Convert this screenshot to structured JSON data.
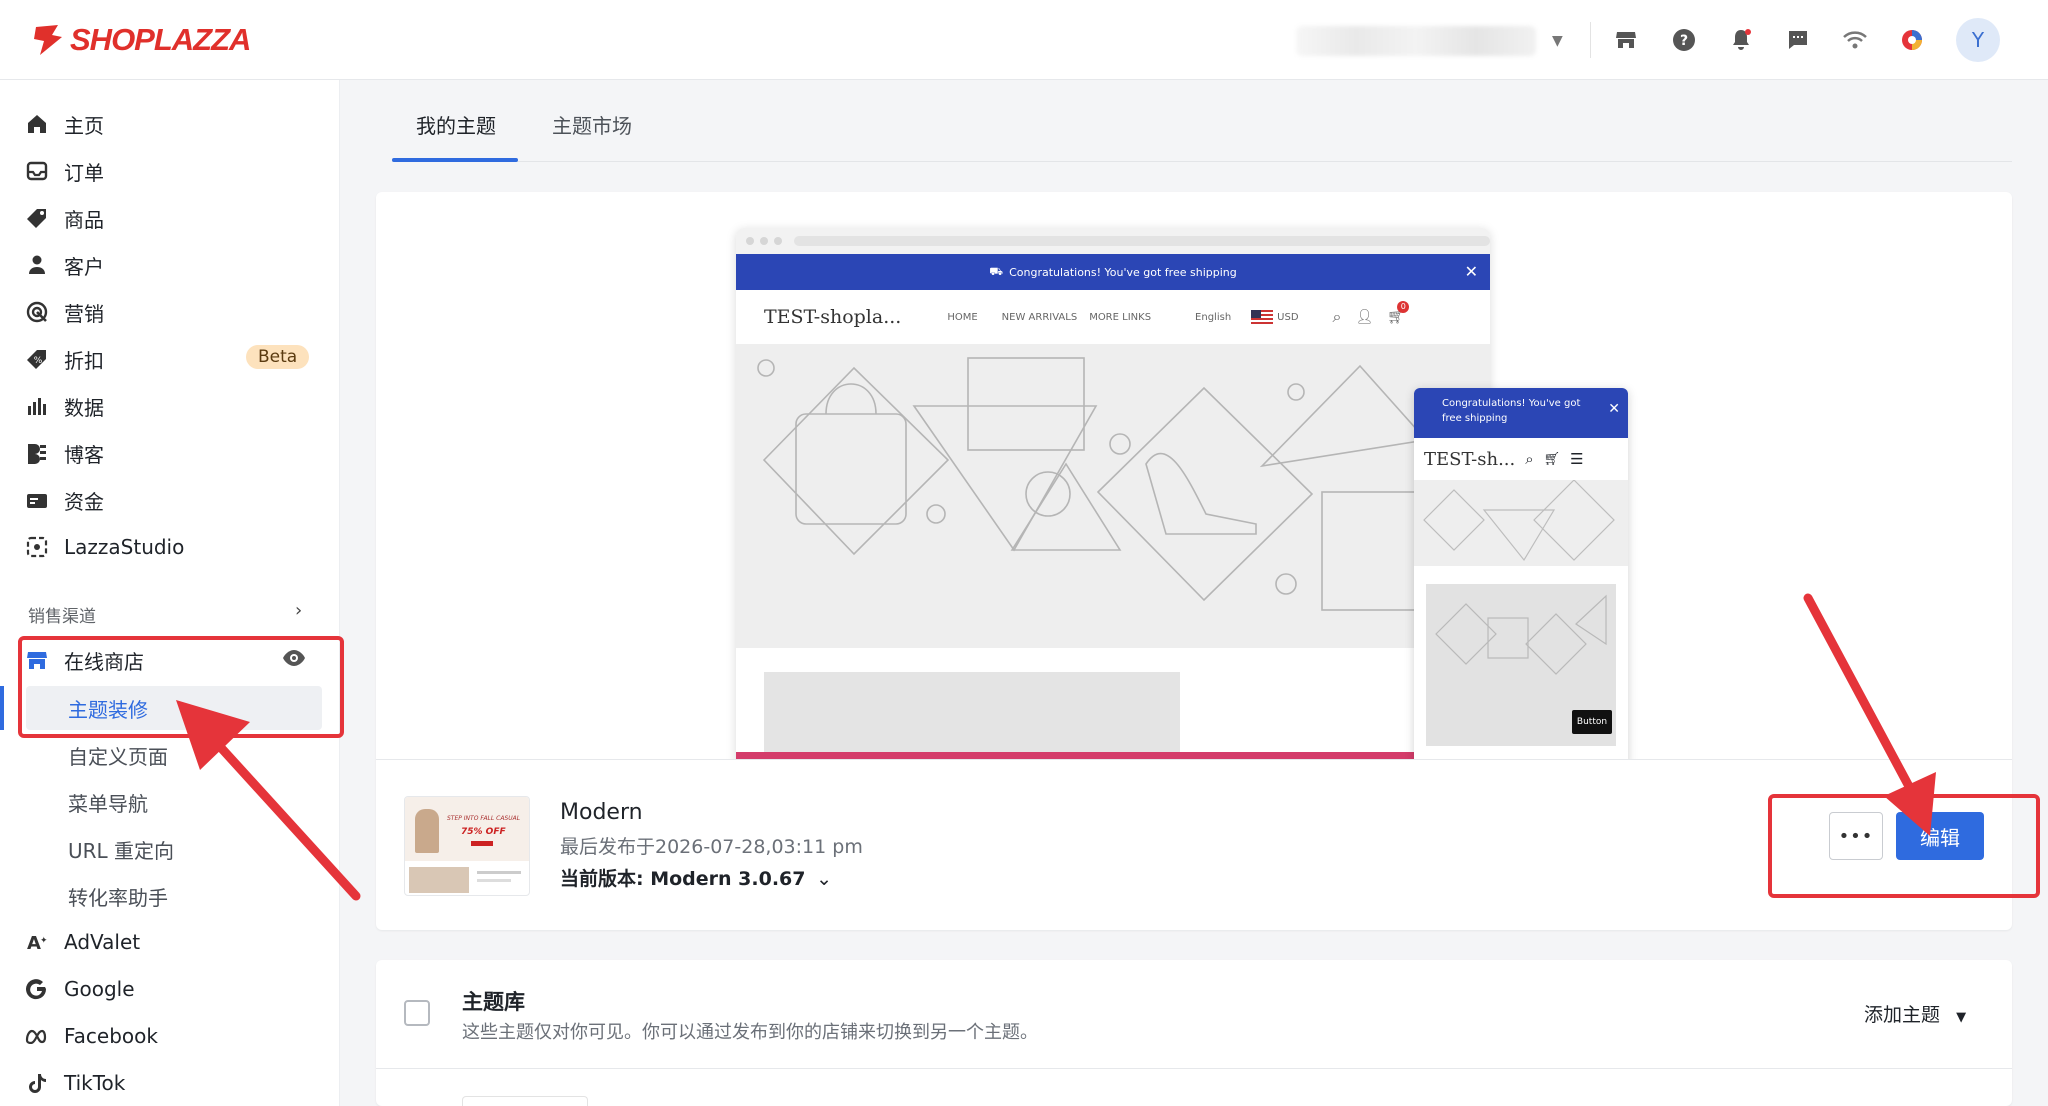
{
  "app": {
    "logo_text": "SHOPLAZZA",
    "avatar_initial": "Y"
  },
  "colors": {
    "brand": "#e0302b",
    "accent": "#2f6bdf",
    "highlight": "#e5343a"
  },
  "topbar_icons": [
    "store-icon",
    "help-icon",
    "bell-icon",
    "chat-icon",
    "wifi-icon",
    "app-icon"
  ],
  "sidebar": {
    "items": [
      {
        "label": "主页",
        "icon": "home-icon"
      },
      {
        "label": "订单",
        "icon": "inbox-icon"
      },
      {
        "label": "商品",
        "icon": "tag-icon"
      },
      {
        "label": "客户",
        "icon": "user-icon"
      },
      {
        "label": "营销",
        "icon": "target-icon"
      },
      {
        "label": "折扣",
        "icon": "discount-icon",
        "badge": "Beta"
      },
      {
        "label": "数据",
        "icon": "bar-chart-icon"
      },
      {
        "label": "博客",
        "icon": "blog-icon"
      },
      {
        "label": "资金",
        "icon": "wallet-icon"
      },
      {
        "label": "LazzaStudio",
        "icon": "studio-icon"
      }
    ],
    "section_label": "销售渠道",
    "online_store": "在线商店",
    "sub_items": [
      "主题装修",
      "自定义页面",
      "菜单导航",
      "URL 重定向",
      "转化率助手"
    ],
    "channels": [
      {
        "label": "AdValet",
        "icon": "advalet-icon"
      },
      {
        "label": "Google",
        "icon": "google-icon"
      },
      {
        "label": "Facebook",
        "icon": "meta-icon"
      },
      {
        "label": "TikTok",
        "icon": "tiktok-icon"
      }
    ]
  },
  "tabs": [
    "我的主题",
    "主题市场"
  ],
  "preview": {
    "banner": "Congratulations!  You've got free shipping",
    "desktop_brand": "TEST-shopla...",
    "nav": [
      "HOME",
      "NEW ARRIVALS",
      "MORE LINKS"
    ],
    "language": "English",
    "currency": "USD",
    "cart_count": "0",
    "mobile_banner": "Congratulations!  You've got free shipping",
    "mobile_brand": "TEST-sh...",
    "button_label": "Button",
    "thumb_text": "STEP INTO FALL CASUAL",
    "thumb_sale": "75% OFF"
  },
  "current_theme": {
    "name": "Modern",
    "published": "最后发布于2026-07-28,03:11 pm",
    "version": "当前版本: Modern 3.0.67",
    "more_label": "•••",
    "edit_label": "编辑"
  },
  "library": {
    "title": "主题库",
    "description": "这些主题仅对你可见。你可以通过发布到你的店铺来切换到另一个主题。",
    "add_label": "添加主题"
  }
}
